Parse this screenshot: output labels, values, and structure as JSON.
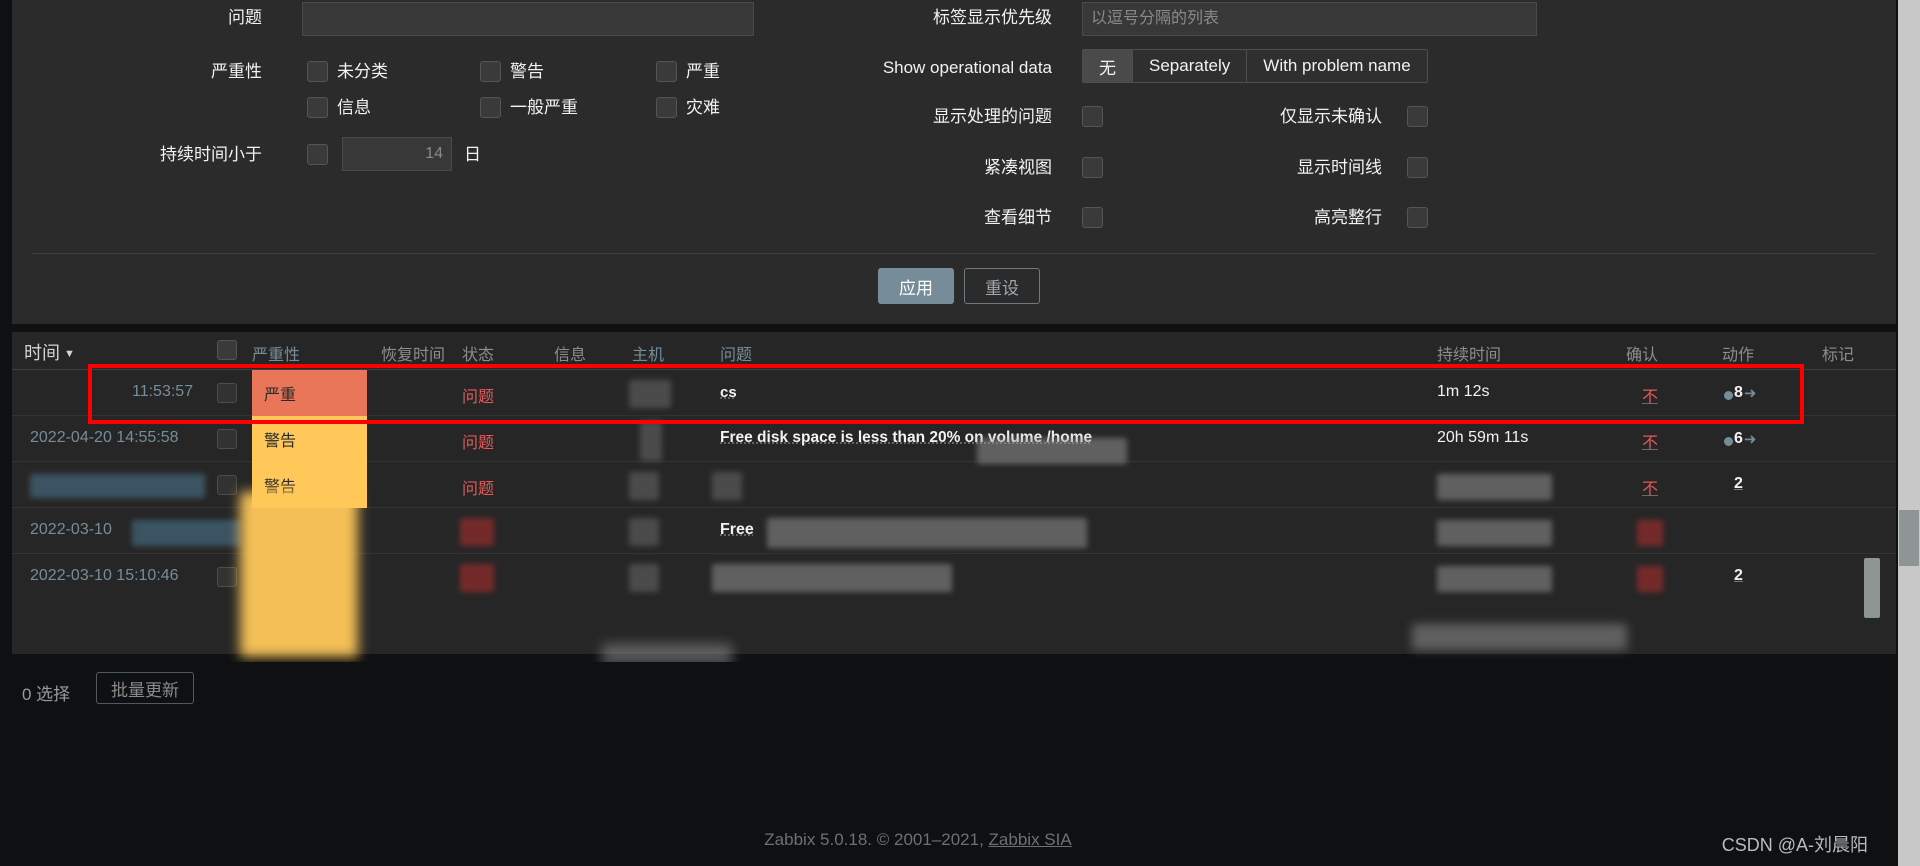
{
  "filter": {
    "problem_label": "问题",
    "problem_value": "",
    "severity_label": "严重性",
    "severity_options": [
      {
        "label": "未分类",
        "checked": false
      },
      {
        "label": "警告",
        "checked": false
      },
      {
        "label": "严重",
        "checked": false
      },
      {
        "label": "信息",
        "checked": false
      },
      {
        "label": "一般严重",
        "checked": false
      },
      {
        "label": "灾难",
        "checked": false
      }
    ],
    "duration_label": "持续时间小于",
    "duration_checked": false,
    "duration_value": "",
    "duration_placeholder": "14",
    "duration_unit": "日",
    "tag_priority_label": "标签显示优先级",
    "tag_priority_value": "",
    "tag_priority_placeholder": "以逗号分隔的列表",
    "show_op_data_label": "Show operational data",
    "show_op_data_options": [
      "无",
      "Separately",
      "With problem name"
    ],
    "show_op_data_selected": "无",
    "toggles_left": [
      {
        "label": "显示处理的问题",
        "checked": false
      },
      {
        "label": "紧凑视图",
        "checked": false
      },
      {
        "label": "查看细节",
        "checked": false
      }
    ],
    "toggles_right": [
      {
        "label": "仅显示未确认",
        "checked": false
      },
      {
        "label": "显示时间线",
        "checked": false
      },
      {
        "label": "高亮整行",
        "checked": false
      }
    ],
    "apply_label": "应用",
    "reset_label": "重设"
  },
  "table": {
    "headers": {
      "time": "时间",
      "severity": "严重性",
      "recovery_time": "恢复时间",
      "status": "状态",
      "info": "信息",
      "host": "主机",
      "problem": "问题",
      "duration": "持续时间",
      "ack": "确认",
      "actions": "动作",
      "tags": "标记"
    },
    "rows": [
      {
        "time": "11:53:57",
        "severity": "严重",
        "severity_class": "sev-high",
        "status": "问题",
        "host": "",
        "problem": "cs",
        "duration": "1m 12s",
        "ack": "不",
        "actions": "8"
      },
      {
        "time": "2022-04-20 14:55:58",
        "severity": "警告",
        "severity_class": "sev-warn",
        "status": "问题",
        "host": "",
        "problem": "Free disk space is less than 20% on volume /home",
        "duration": "20h 59m 11s",
        "ack": "不",
        "actions": "6"
      },
      {
        "time": "",
        "severity": "警告",
        "severity_class": "sev-warn",
        "status": "问题",
        "host": "",
        "problem": "",
        "duration": "",
        "ack": "不",
        "actions": "2"
      },
      {
        "time": "2022-03-10",
        "severity": "",
        "severity_class": "sev-warn",
        "status": "",
        "host": "",
        "problem": "Free",
        "duration": "",
        "ack": "",
        "actions": ""
      },
      {
        "time": "2022-03-10 15:10:46",
        "severity": "",
        "severity_class": "sev-warn",
        "status": "",
        "host": "",
        "problem": "",
        "duration": "",
        "ack": "",
        "actions": "2"
      }
    ]
  },
  "footer": {
    "selected_count": "0 选择",
    "mass_update": "批量更新",
    "copyright_prefix": "Zabbix 5.0.18. © 2001–2021, ",
    "copyright_link": "Zabbix SIA",
    "watermark": "CSDN @A-刘晨阳"
  }
}
